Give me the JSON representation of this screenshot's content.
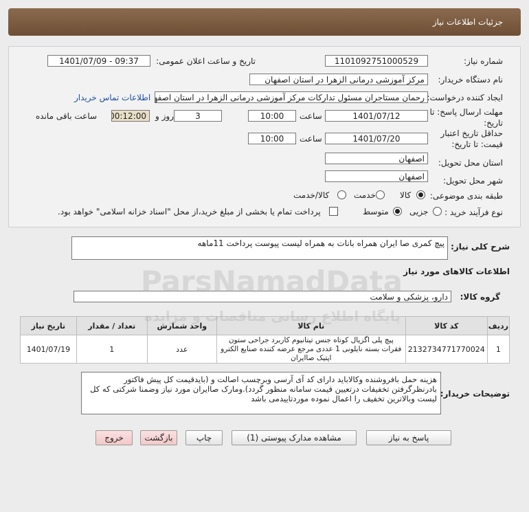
{
  "header": {
    "title": "جزئیات اطلاعات نیاز"
  },
  "form": {
    "need_number_label": "شماره نیاز:",
    "need_number": "1101092751000529",
    "announce_label": "تاریخ و ساعت اعلان عمومی:",
    "announce_value": "1401/07/09 - 09:37",
    "buyer_org_label": "نام دستگاه خریدار:",
    "buyer_org": "مرکز آموزشی درمانی الزهرا در استان اصفهان",
    "requester_label": "ایجاد کننده درخواست:",
    "requester": "رحمان مستاجران مسئول تدارکات مرکز آموزشی درمانی الزهرا در استان اصفهان",
    "contact_link": "اطلاعات تماس خریدار",
    "deadline_label_1": "مهلت ارسال پاسخ: تا",
    "deadline_label_2": "تاریخ:",
    "deadline_date": "1401/07/12",
    "time_label": "ساعت",
    "deadline_time": "10:00",
    "days_value": "3",
    "days_label": "روز و",
    "remaining_value": "00:12:00",
    "remaining_label": "ساعت باقی مانده",
    "validity_label_1": "حداقل تاریخ اعتبار",
    "validity_label_2": "قیمت: تا تاریخ:",
    "validity_date": "1401/07/20",
    "validity_time": "10:00",
    "province_label": "استان محل تحویل:",
    "province": "اصفهان",
    "city_label": "شهر محل تحویل:",
    "city": "اصفهان",
    "category_label": "طبقه بندی موضوعی:",
    "category_options": [
      "کالا",
      "خدمت",
      "کالا/خدمت"
    ],
    "process_label": "نوع فرآیند خرید :",
    "process_options": [
      "جزیی",
      "متوسط"
    ],
    "payment_text": "پرداخت تمام یا بخشی از مبلغ خرید،از محل \"اسناد خزانه اسلامی\" خواهد بود."
  },
  "description": {
    "label": "شرح کلی نیاز:",
    "text": "پیچ کمری صا ایران همراه بانات به همراه لیست پیوست پرداخت 11ماهه"
  },
  "goods_section": {
    "title": "اطلاعات کالاهای مورد نیاز",
    "group_label": "گروه کالا:",
    "group_value": "دارو، پزشکی و سلامت"
  },
  "table": {
    "headers": [
      "ردیف",
      "کد کالا",
      "نام کالا",
      "واحد شمارش",
      "تعداد / مقدار",
      "تاریخ نیاز"
    ],
    "rows": [
      {
        "row": "1",
        "code": "2132734771770024",
        "name": "پیچ پلی اگزیال کوتاه جنس تیتانیوم کاربرد جراحی ستون فقرات بسته نایلونی 1 عددی مرجع عرضه کننده صنایع الکترو اپتیک صاایران",
        "unit": "عدد",
        "qty": "1",
        "date": "1401/07/19"
      }
    ]
  },
  "buyer_notes": {
    "label": "توضیحات خریدار:",
    "text": "هزینه حمل بافروشنده وکالاباید دارای کد آی آرسی وبرچسب اصالت و (بایدقیمت کل پیش فاکتور بادرنظرگرفتن تخفیفات درتعیین قیمت سامانه منظور گردد).ومارک صاایران مورد نیاز وضمنا شرکتی که کل لیست  وبالاترین تخفیف را اعمال نموده موردتاییدمی باشد"
  },
  "buttons": {
    "reply": "پاسخ به نیاز",
    "attachments": "مشاهده مدارک پیوستی (1)",
    "print": "چاپ",
    "back": "بازگشت",
    "exit": "خروج"
  },
  "watermark": {
    "brand": "ParsNamadData",
    "tagline": "پایگاه اطلاع رسانی مناقصات و مزایده"
  }
}
